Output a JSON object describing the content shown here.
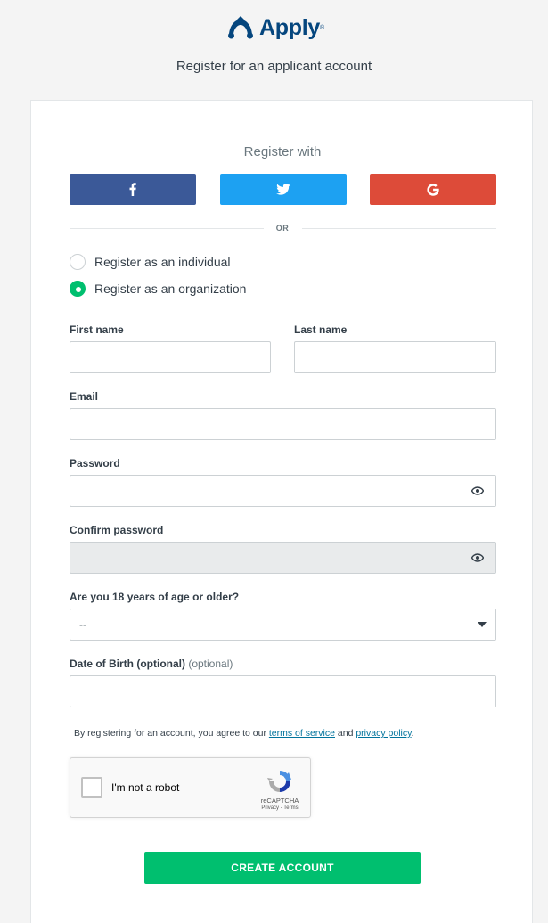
{
  "brand": {
    "name": "Apply",
    "reg_mark": "®"
  },
  "subtitle": "Register for an applicant account",
  "social": {
    "heading": "Register with",
    "facebook_icon": "facebook-icon",
    "twitter_icon": "twitter-icon",
    "google_icon": "google-icon",
    "or_text": "OR"
  },
  "colors": {
    "facebook": "#3b5998",
    "twitter": "#1da1f2",
    "google": "#dd4b39",
    "accent": "#00bf6f",
    "brand": "#05467e"
  },
  "account_type": {
    "options": [
      {
        "label": "Register as an individual",
        "selected": false
      },
      {
        "label": "Register as an organization",
        "selected": true
      }
    ]
  },
  "form": {
    "first_name": {
      "label": "First name",
      "value": ""
    },
    "last_name": {
      "label": "Last name",
      "value": ""
    },
    "email": {
      "label": "Email",
      "value": ""
    },
    "password": {
      "label": "Password",
      "value": ""
    },
    "confirm_password": {
      "label": "Confirm password",
      "value": ""
    },
    "age": {
      "label": "Are you 18 years of age or older?",
      "value": "--"
    },
    "dob": {
      "label": "Date of Birth (optional)",
      "optional_tag": "(optional)",
      "value": ""
    }
  },
  "terms": {
    "prefix": "By registering for an account, you agree to our ",
    "tos": "terms of service",
    "and": " and ",
    "privacy": "privacy policy",
    "suffix": "."
  },
  "captcha": {
    "label": "I'm not a robot",
    "brand": "reCAPTCHA",
    "links": "Privacy - Terms"
  },
  "submit_label": "CREATE ACCOUNT"
}
